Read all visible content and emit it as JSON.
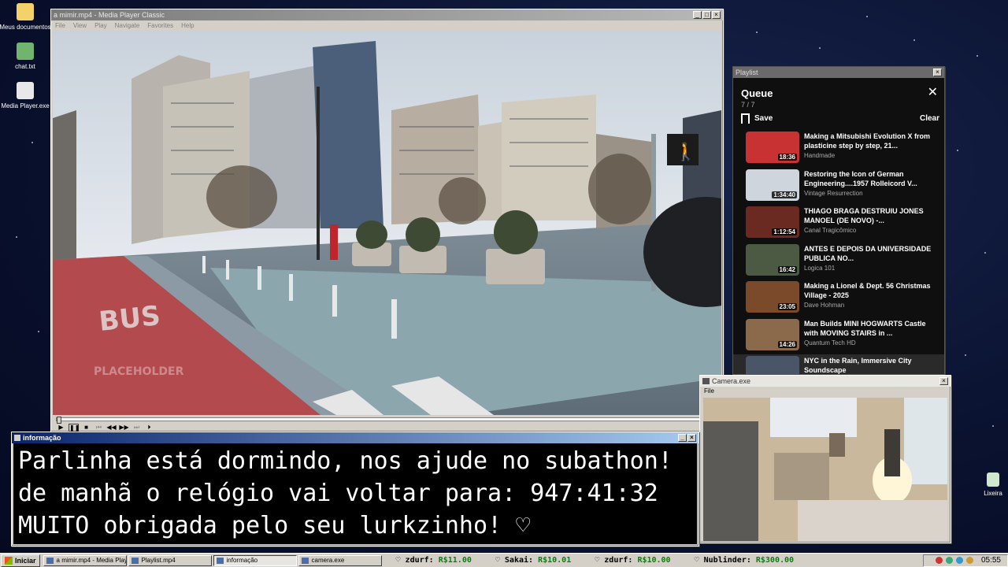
{
  "desktop": {
    "icons": [
      {
        "label": "Meus documentos",
        "color": "#f3d26a"
      },
      {
        "label": "chat.txt",
        "color": "#6fb46f"
      },
      {
        "label": "Media Player.exe",
        "color": "#e8e8e8"
      }
    ],
    "recycle_label": "Lixeira"
  },
  "media_player": {
    "title": "a mimir.mp4 - Media Player Classic",
    "menu": [
      "File",
      "View",
      "Play",
      "Navigate",
      "Favorites",
      "Help"
    ],
    "watermark": "PLACEHOLDER",
    "video_icon": "pedestrian-walk-signal"
  },
  "playlist_window": {
    "title": "Playlist",
    "queue_title": "Queue",
    "count": "7 / 7",
    "save_label": "Save",
    "clear_label": "Clear",
    "items": [
      {
        "title": "Making a Mitsubishi Evolution X from plasticine step by step, 21...",
        "channel": "Handmade",
        "duration": "18:36",
        "color": "#c83232"
      },
      {
        "title": "Restoring the Icon of German Engineering....1957 Rolleicord V...",
        "channel": "Vintage Resurrection",
        "duration": "1:34:40",
        "color": "#cfd5dc"
      },
      {
        "title": "THIAGO BRAGA DESTRUIU JONES MANOEL (DE NOVO) -...",
        "channel": "Canal Tragicômico",
        "duration": "1:12:54",
        "color": "#6a2a22"
      },
      {
        "title": "ANTES E DEPOIS DA UNIVERSIDADE PUBLICA NO...",
        "channel": "Logica 101",
        "duration": "16:42",
        "color": "#4c5a44"
      },
      {
        "title": "Making a Lionel & Dept. 56 Christmas Village - 2025",
        "channel": "Dave Hohman",
        "duration": "23:05",
        "color": "#7a4a2a"
      },
      {
        "title": "Man Builds MINI HOGWARTS Castle with MOVING STAIRS in ...",
        "channel": "Quantum Tech HD",
        "duration": "14:26",
        "color": "#8a6a4a"
      },
      {
        "title": "NYC in the Rain, Immersive City Soundscape",
        "channel": "",
        "duration": "",
        "color": "#4a5668"
      }
    ]
  },
  "camera_window": {
    "title": "Camera.exe",
    "menu": "File"
  },
  "info_window": {
    "title": "informação",
    "lines": [
      "Parlinha está dormindo, nos ajude no subathon!",
      "de manhã o relógio vai voltar para:  947:41:32",
      "MUITO obrigada pelo seu lurkzinho! ♡"
    ]
  },
  "taskbar": {
    "start_label": "Iniciar",
    "tasks": [
      {
        "label": "a mimir.mp4 - Media Playe...",
        "pressed": false
      },
      {
        "label": "Playlist.mp4",
        "pressed": false
      },
      {
        "label": "informação",
        "pressed": true
      },
      {
        "label": "camera.exe",
        "pressed": false
      }
    ],
    "ticker": [
      {
        "name": "♡ zdurf:",
        "amount": "R$11.00"
      },
      {
        "name": "♡ Sakai:",
        "amount": "R$10.01"
      },
      {
        "name": "♡ zdurf:",
        "amount": "R$10.00"
      },
      {
        "name": "♡ Nublinder:",
        "amount": "R$300.00"
      }
    ],
    "clock": "05:55"
  }
}
